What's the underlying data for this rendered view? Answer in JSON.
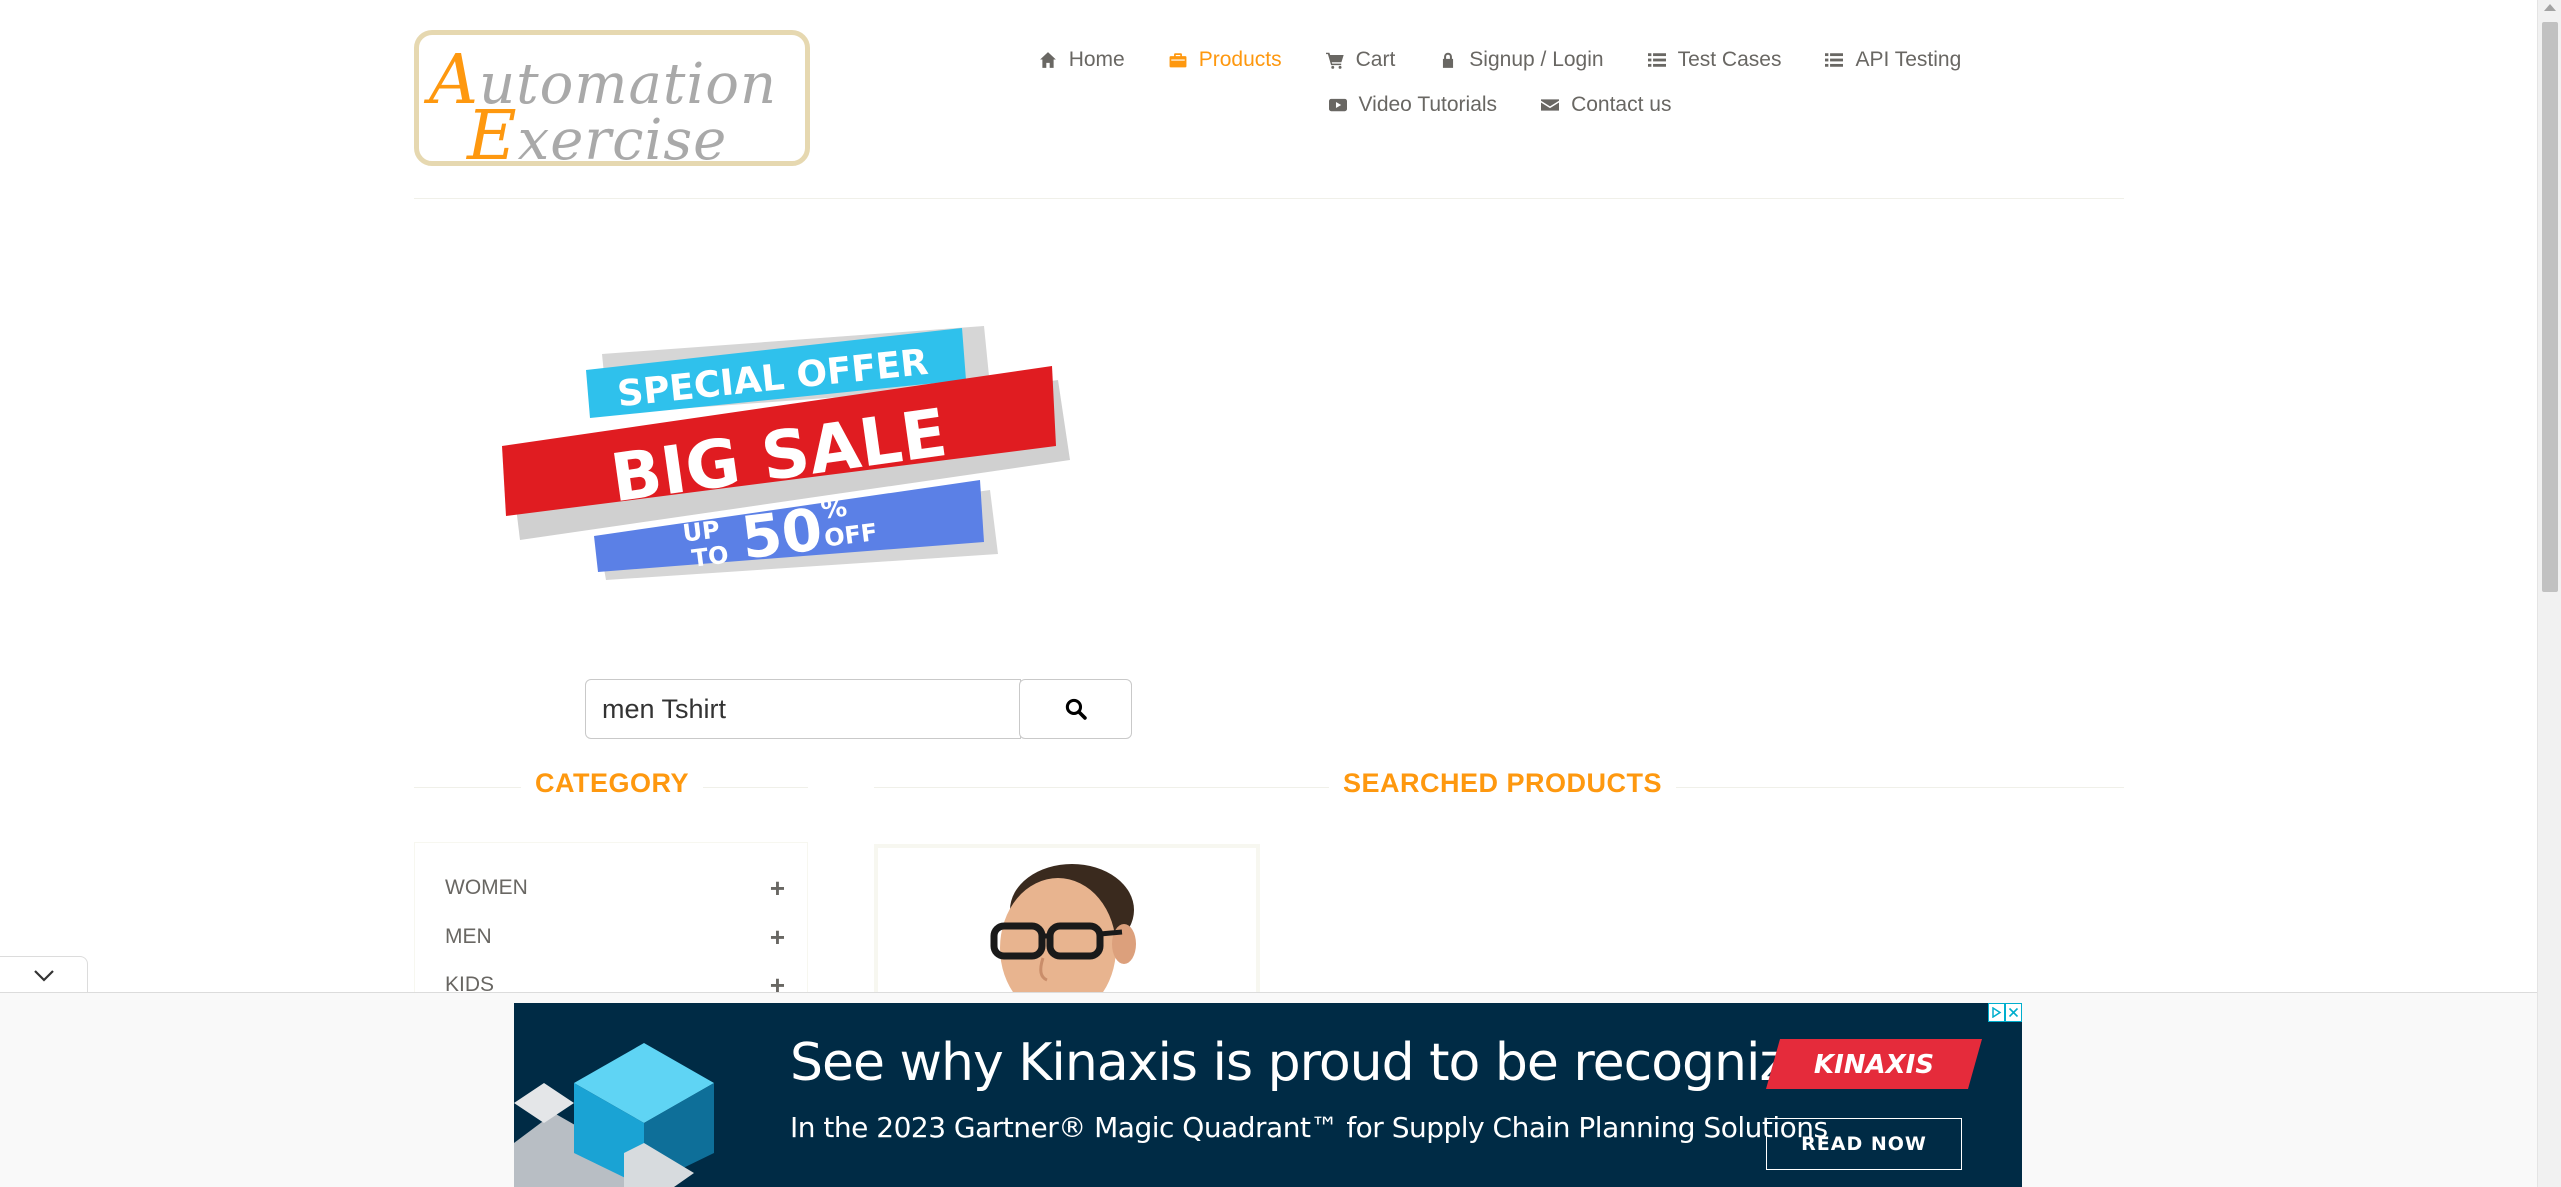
{
  "logo": {
    "line1_cap": "A",
    "line1_rest": "utomation",
    "line2_cap": "E",
    "line2_rest": "xercise"
  },
  "nav": {
    "row1": [
      {
        "label": "Home",
        "icon": "home-icon",
        "active": false
      },
      {
        "label": "Products",
        "icon": "briefcase-icon",
        "active": true
      },
      {
        "label": "Cart",
        "icon": "cart-icon",
        "active": false
      },
      {
        "label": "Signup / Login",
        "icon": "lock-icon",
        "active": false
      },
      {
        "label": "Test Cases",
        "icon": "list-icon",
        "active": false
      },
      {
        "label": "API Testing",
        "icon": "list-icon",
        "active": false
      }
    ],
    "row2": [
      {
        "label": "Video Tutorials",
        "icon": "youtube-play-icon",
        "active": false
      },
      {
        "label": "Contact us",
        "icon": "envelope-icon",
        "active": false
      }
    ]
  },
  "banner": {
    "line1": "SPECIAL OFFER",
    "line2": "BIG SALE",
    "up": "UP",
    "to": "TO",
    "amount": "50",
    "percent": "%",
    "off": "OFF"
  },
  "search": {
    "value": "men Tshirt",
    "icon": "search-icon"
  },
  "sections": {
    "category_title": "CATEGORY",
    "products_title": "SEARCHED PRODUCTS"
  },
  "categories": [
    {
      "label": "WOMEN"
    },
    {
      "label": "MEN"
    },
    {
      "label": "KIDS"
    }
  ],
  "ad": {
    "headline": "See why Kinaxis is proud to be recognized",
    "subline": "In the 2023 Gartner® Magic Quadrant™ for Supply Chain Planning Solutions",
    "brand": "KINAXIS",
    "cta": "READ NOW"
  },
  "colors": {
    "accent": "#fe980f",
    "text": "#696763",
    "ad_bg": "#002b45",
    "brand_red": "#e52b3b"
  }
}
